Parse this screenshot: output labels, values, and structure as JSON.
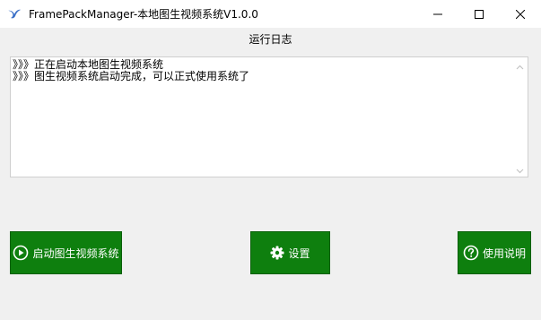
{
  "window": {
    "title": "FramePackManager-本地图生视频系统V1.0.0",
    "app_icon": "bird-logo-icon",
    "controls": {
      "minimize": "minimize-icon",
      "maximize": "maximize-icon",
      "close": "close-icon"
    }
  },
  "log": {
    "label": "运行日志",
    "lines": [
      "》》》正在启动本地图生视频系统",
      "》》》图生视频系统启动完成，可以正式使用系统了"
    ]
  },
  "buttons": {
    "start": {
      "label": "启动图生视频系统",
      "icon": "play-circle-icon"
    },
    "settings": {
      "label": "设置",
      "icon": "gear-icon"
    },
    "help": {
      "label": "使用说明",
      "icon": "question-circle-icon"
    }
  },
  "colors": {
    "button_bg": "#0e7f0e",
    "button_text": "#ffffff",
    "window_bg": "#f0f0f0"
  }
}
